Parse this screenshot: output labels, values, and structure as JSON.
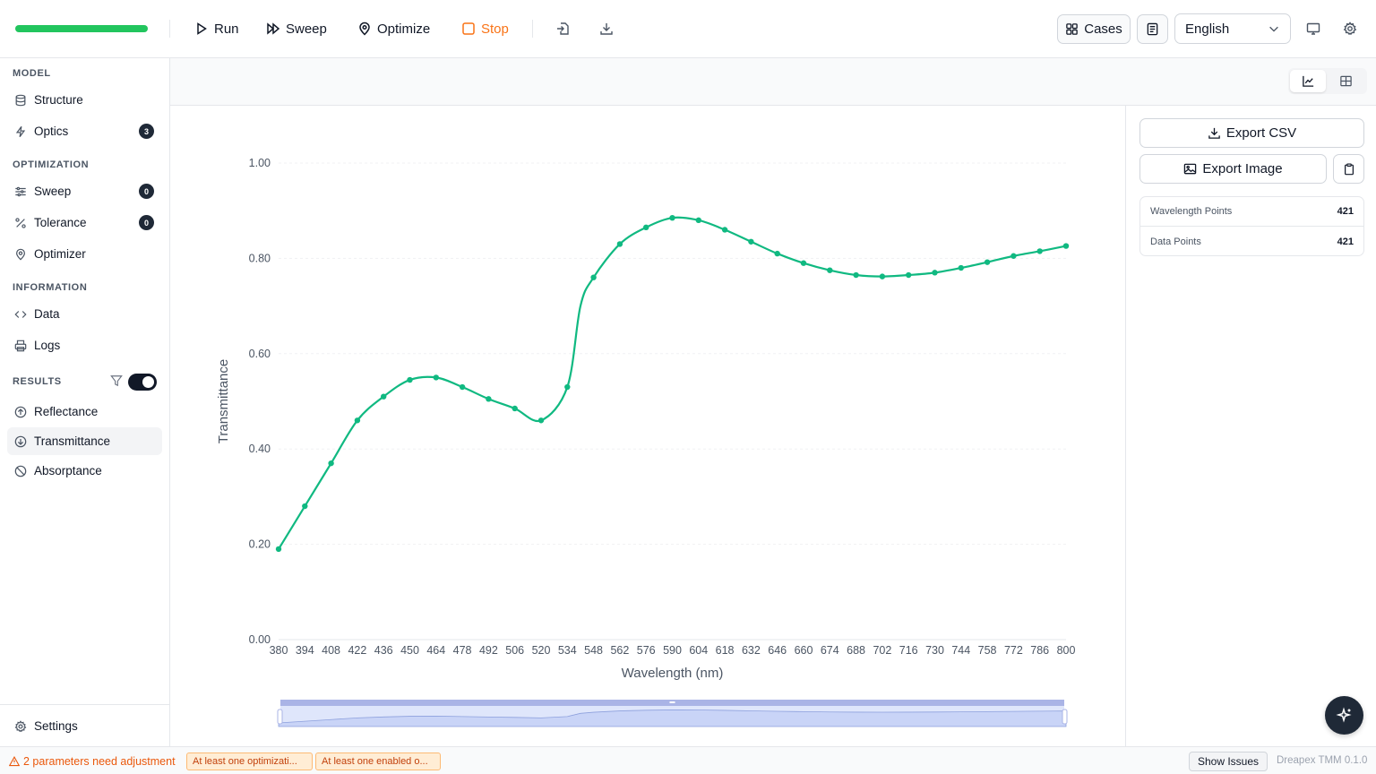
{
  "toolbar": {
    "progress": 1.0,
    "run_label": "Run",
    "sweep_label": "Sweep",
    "optimize_label": "Optimize",
    "stop_label": "Stop",
    "cases_label": "Cases",
    "language": "English"
  },
  "sidebar": {
    "sections": {
      "model": "MODEL",
      "optimization": "OPTIMIZATION",
      "information": "INFORMATION",
      "results": "RESULTS"
    },
    "items": {
      "structure": "Structure",
      "optics": "Optics",
      "optics_badge": "3",
      "sweep": "Sweep",
      "sweep_badge": "0",
      "tolerance": "Tolerance",
      "tolerance_badge": "0",
      "optimizer": "Optimizer",
      "data": "Data",
      "logs": "Logs",
      "reflectance": "Reflectance",
      "transmittance": "Transmittance",
      "absorptance": "Absorptance"
    },
    "results_toggle_on": true,
    "settings_label": "Settings"
  },
  "right_panel": {
    "export_csv": "Export CSV",
    "export_image": "Export Image",
    "stats": [
      {
        "label": "Wavelength Points",
        "value": "421"
      },
      {
        "label": "Data Points",
        "value": "421"
      }
    ]
  },
  "status": {
    "warning": "2 parameters need adjustment",
    "chips": [
      "At least one optimizati...",
      "At least one enabled o..."
    ],
    "show_issues": "Show Issues",
    "version": "Dreapex TMM 0.1.0"
  },
  "colors": {
    "accent": "#10b981",
    "warning": "#ea580c"
  },
  "chart_data": {
    "type": "line",
    "xlabel": "Wavelength (nm)",
    "ylabel": "Transmittance",
    "x_ticks": [
      "380",
      "394",
      "408",
      "422",
      "436",
      "450",
      "464",
      "478",
      "492",
      "506",
      "520",
      "534",
      "548",
      "562",
      "576",
      "590",
      "604",
      "618",
      "632",
      "646",
      "660",
      "674",
      "688",
      "702",
      "716",
      "730",
      "744",
      "758",
      "772",
      "786",
      "800"
    ],
    "y_ticks": [
      "0.00",
      "0.20",
      "0.40",
      "0.60",
      "0.80",
      "1.00"
    ],
    "xlim": [
      380,
      800
    ],
    "ylim": [
      0,
      1.0
    ],
    "grid": true,
    "series": [
      {
        "x": [
          380,
          394,
          408,
          422,
          436,
          450,
          464,
          478,
          492,
          506,
          520,
          534,
          541,
          548,
          562,
          576,
          590,
          604,
          618,
          632,
          646,
          660,
          674,
          688,
          702,
          716,
          730,
          744,
          758,
          772,
          786,
          800
        ],
        "y": [
          0.19,
          0.28,
          0.37,
          0.46,
          0.51,
          0.545,
          0.55,
          0.53,
          0.505,
          0.485,
          0.46,
          0.53,
          0.7,
          0.76,
          0.83,
          0.865,
          0.885,
          0.88,
          0.86,
          0.835,
          0.81,
          0.79,
          0.775,
          0.765,
          0.762,
          0.765,
          0.77,
          0.78,
          0.792,
          0.805,
          0.815,
          0.826
        ]
      }
    ],
    "markers": [
      0,
      1,
      2,
      3,
      4,
      5,
      6,
      7,
      8,
      9,
      10,
      11,
      13,
      14,
      15,
      16,
      17,
      18,
      19,
      20,
      21,
      22,
      23,
      24,
      25,
      26,
      27,
      28,
      29,
      30,
      31
    ]
  }
}
